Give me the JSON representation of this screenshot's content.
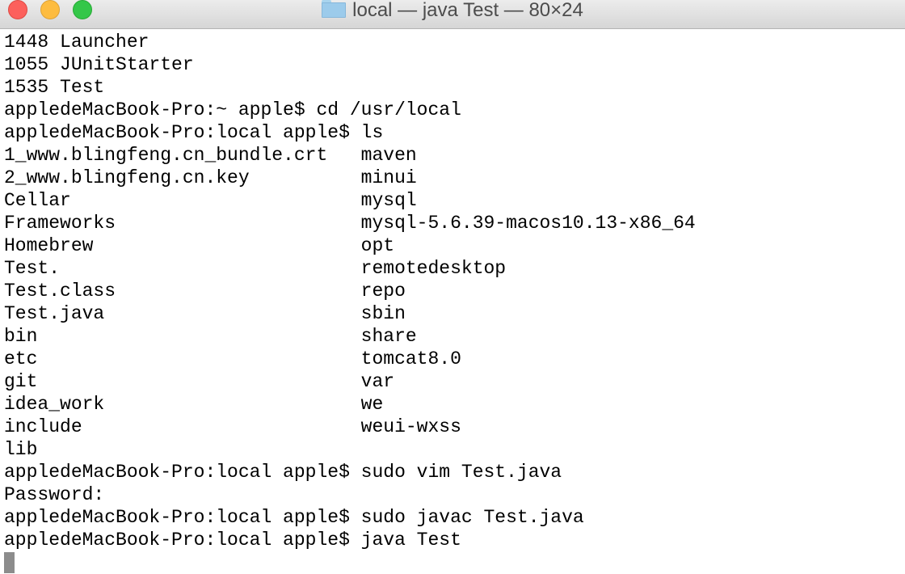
{
  "window": {
    "title": "local — java Test — 80×24",
    "folder_icon": "folder-icon"
  },
  "terminal": {
    "lines": [
      "1448 Launcher",
      "1055 JUnitStarter",
      "1535 Test",
      "appledeMacBook-Pro:~ apple$ cd /usr/local",
      "appledeMacBook-Pro:local apple$ ls",
      "1_www.blingfeng.cn_bundle.crt   maven",
      "2_www.blingfeng.cn.key          minui",
      "Cellar                          mysql",
      "Frameworks                      mysql-5.6.39-macos10.13-x86_64",
      "Homebrew                        opt",
      "Test.                           remotedesktop",
      "Test.class                      repo",
      "Test.java                       sbin",
      "bin                             share",
      "etc                             tomcat8.0",
      "git                             var",
      "idea_work                       we",
      "include                         weui-wxss",
      "lib",
      "appledeMacBook-Pro:local apple$ sudo vim Test.java",
      "Password:",
      "appledeMacBook-Pro:local apple$ sudo javac Test.java",
      "appledeMacBook-Pro:local apple$ java Test"
    ]
  }
}
